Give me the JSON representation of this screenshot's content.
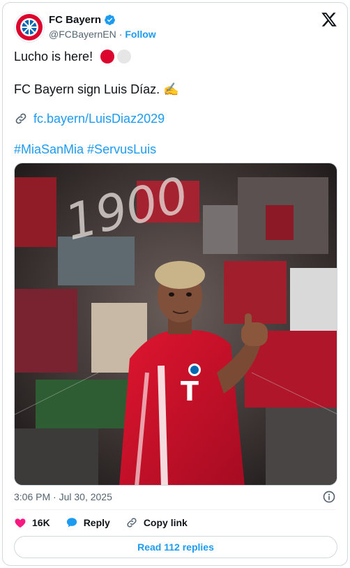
{
  "header": {
    "display_name": "FC Bayern",
    "handle": "@FCBayernEN",
    "separator": "·",
    "follow_label": "Follow",
    "verified": true
  },
  "body": {
    "line1": "Lucho is here!",
    "line2": "FC Bayern sign Luis Díaz. ✍️",
    "link": "fc.bayern/LuisDiaz2029",
    "hashtags": "#MiaSanMia #ServusLuis"
  },
  "media": {
    "alt": "Luis Díaz in FC Bayern kit pointing at the camera",
    "wall_text": "1900"
  },
  "footer": {
    "timestamp": "3:06 PM · Jul 30, 2025",
    "likes": "16K",
    "reply_label": "Reply",
    "copy_link_label": "Copy link",
    "read_replies": "Read 112 replies"
  },
  "colors": {
    "accent": "#1d9bf0",
    "bayern_red": "#dc052d",
    "like_pink": "#f91880",
    "muted": "#536471"
  },
  "icons": [
    "bayern-logo-icon",
    "verified-badge-icon",
    "x-logo-icon",
    "link-icon",
    "info-icon",
    "heart-icon",
    "reply-bubble-icon",
    "copy-link-icon",
    "red-circle-icon",
    "white-circle-icon"
  ]
}
